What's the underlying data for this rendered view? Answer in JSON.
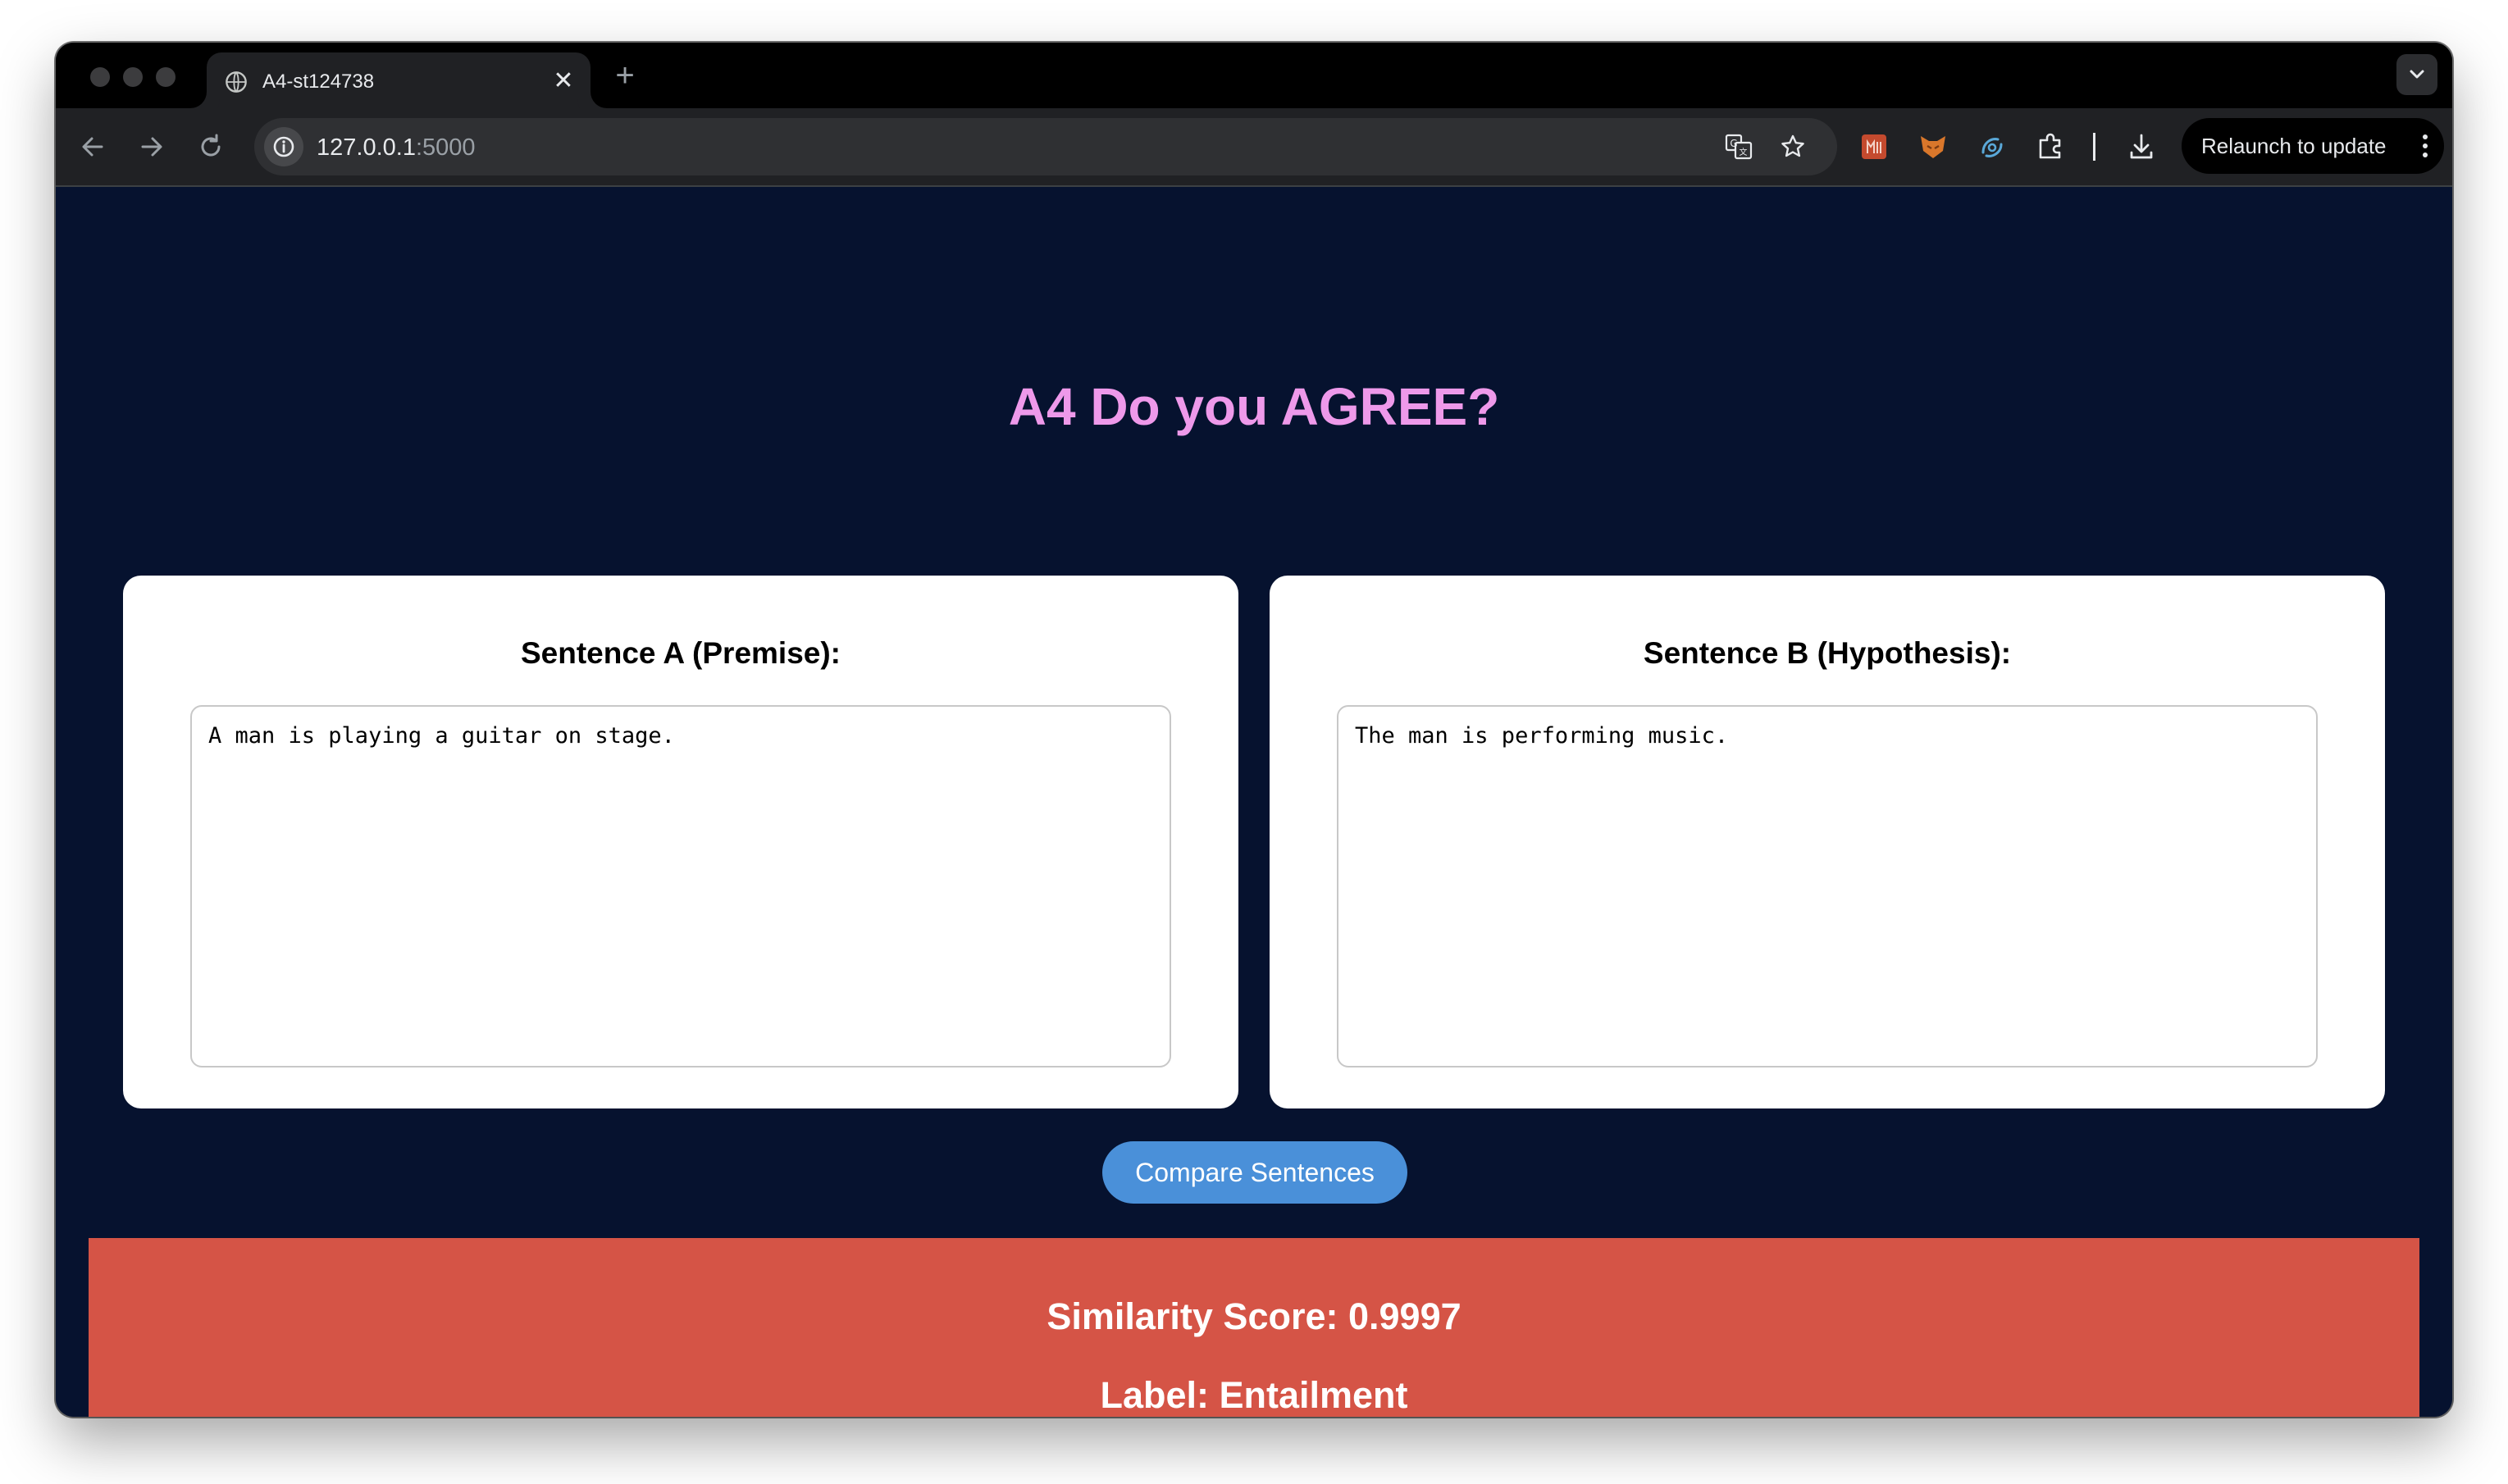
{
  "browser": {
    "tab": {
      "title": "A4-st124738",
      "close_glyph": "✕"
    },
    "new_tab_glyph": "+",
    "address": {
      "host": "127.0.0.1",
      "port": ":5000"
    },
    "relaunch_label": "Relaunch to update",
    "icons": [
      "globe-icon",
      "back-arrow-icon",
      "forward-arrow-icon",
      "reload-icon",
      "site-info-icon",
      "translate-icon",
      "bookmark-star-icon",
      "download-icon",
      "extensions-puzzle-icon",
      "kebab-menu-icon"
    ]
  },
  "page": {
    "title": "A4 Do you AGREE?",
    "premise": {
      "label": "Sentence A (Premise):",
      "value": "A man is playing a guitar on stage."
    },
    "hypothesis": {
      "label": "Sentence B (Hypothesis):",
      "value": "The man is performing music."
    },
    "compare_label": "Compare Sentences",
    "result": {
      "score_text": "Similarity Score: 0.9997",
      "label_text": "Label: Entailment"
    }
  },
  "colors": {
    "background": "#06122f",
    "title": "#ee99ea",
    "button": "#4a90d9",
    "result_panel": "#d55446"
  }
}
